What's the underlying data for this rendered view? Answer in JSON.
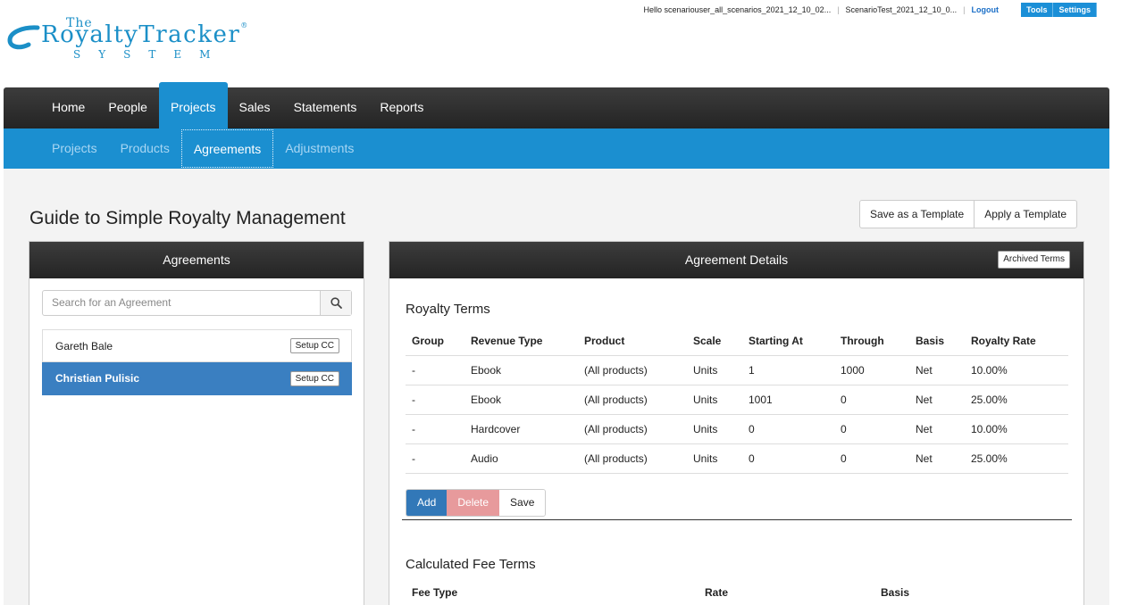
{
  "brand": {
    "the": "The",
    "name": "RoyaltyTracker",
    "reg": "®",
    "system": "SYSTEM"
  },
  "topbar": {
    "greeting": "Hello scenariouser_all_scenarios_2021_12_10_02...",
    "account": "ScenarioTest_2021_12_10_0...",
    "logout": "Logout",
    "tools": "Tools",
    "settings": "Settings"
  },
  "mainnav": [
    "Home",
    "People",
    "Projects",
    "Sales",
    "Statements",
    "Reports"
  ],
  "subnav": [
    "Projects",
    "Products",
    "Agreements",
    "Adjustments"
  ],
  "page": {
    "title": "Guide to Simple Royalty Management",
    "save_template": "Save as a Template",
    "apply_template": "Apply a Template"
  },
  "agreements": {
    "header": "Agreements",
    "search_placeholder": "Search for an Agreement",
    "items": [
      {
        "name": "Gareth Bale",
        "button": "Setup CC"
      },
      {
        "name": "Christian Pulisic",
        "button": "Setup CC"
      }
    ]
  },
  "details": {
    "header": "Agreement Details",
    "archived": "Archived Terms",
    "royalty_title": "Royalty Terms",
    "columns": [
      "Group",
      "Revenue Type",
      "Product",
      "Scale",
      "Starting At",
      "Through",
      "Basis",
      "Royalty Rate"
    ],
    "rows": [
      [
        "-",
        "Ebook",
        "(All products)",
        "Units",
        "1",
        "1000",
        "Net",
        "10.00%"
      ],
      [
        "-",
        "Ebook",
        "(All products)",
        "Units",
        "1001",
        "0",
        "Net",
        "25.00%"
      ],
      [
        "-",
        "Hardcover",
        "(All products)",
        "Units",
        "0",
        "0",
        "Net",
        "10.00%"
      ],
      [
        "-",
        "Audio",
        "(All products)",
        "Units",
        "0",
        "0",
        "Net",
        "25.00%"
      ]
    ],
    "add": "Add",
    "delete": "Delete",
    "save": "Save",
    "fee_title": "Calculated Fee Terms",
    "fee_columns": [
      "Fee Type",
      "Rate",
      "Basis"
    ]
  },
  "colors": {
    "accent": "#1b8fd0",
    "selected": "#3a7fc1",
    "delete": "#e79a9c"
  }
}
